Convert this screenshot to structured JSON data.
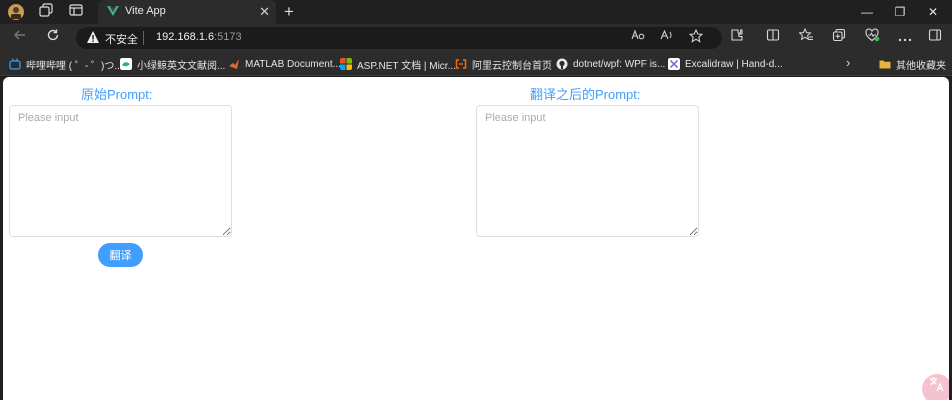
{
  "tabbar": {
    "tab_title": "Vite App",
    "close_glyph": "✕",
    "new_tab_glyph": "+"
  },
  "window_controls": {
    "minimize": "—",
    "maximize": "❐",
    "close": "✕"
  },
  "toolbar": {
    "security_text": "不安全",
    "url_host": "192.168.1.6",
    "url_port": ":5173"
  },
  "bookmarks": [
    {
      "label": "哔哩哔哩 ( ゜- ゜)つ...",
      "icon": "bilibili-icon",
      "color": "#2e9ef8"
    },
    {
      "label": "小绿鲸英文文献阅...",
      "icon": "whale-icon",
      "color": "#2fb36b"
    },
    {
      "label": "MATLAB Document...",
      "icon": "matlab-icon",
      "color": "#e16737"
    },
    {
      "label": "ASP.NET 文档 | Micr...",
      "icon": "microsoft-icon",
      "color": "#f25022"
    },
    {
      "label": "阿里云控制台首页",
      "icon": "aliyun-icon",
      "color": "#ff6a00"
    },
    {
      "label": "dotnet/wpf: WPF is...",
      "icon": "github-icon",
      "color": "#e8e8e8"
    },
    {
      "label": "Excalidraw | Hand-d...",
      "icon": "excalidraw-icon",
      "color": "#6965db"
    },
    {
      "label": "其他收藏夹",
      "icon": "folder-icon",
      "color": "#e8b441"
    }
  ],
  "page": {
    "source_label": "原始Prompt:",
    "source_placeholder": "Please input",
    "target_label": "翻译之后的Prompt:",
    "target_placeholder": "Please input",
    "translate_label": "翻译",
    "accent_color": "#409eff"
  }
}
